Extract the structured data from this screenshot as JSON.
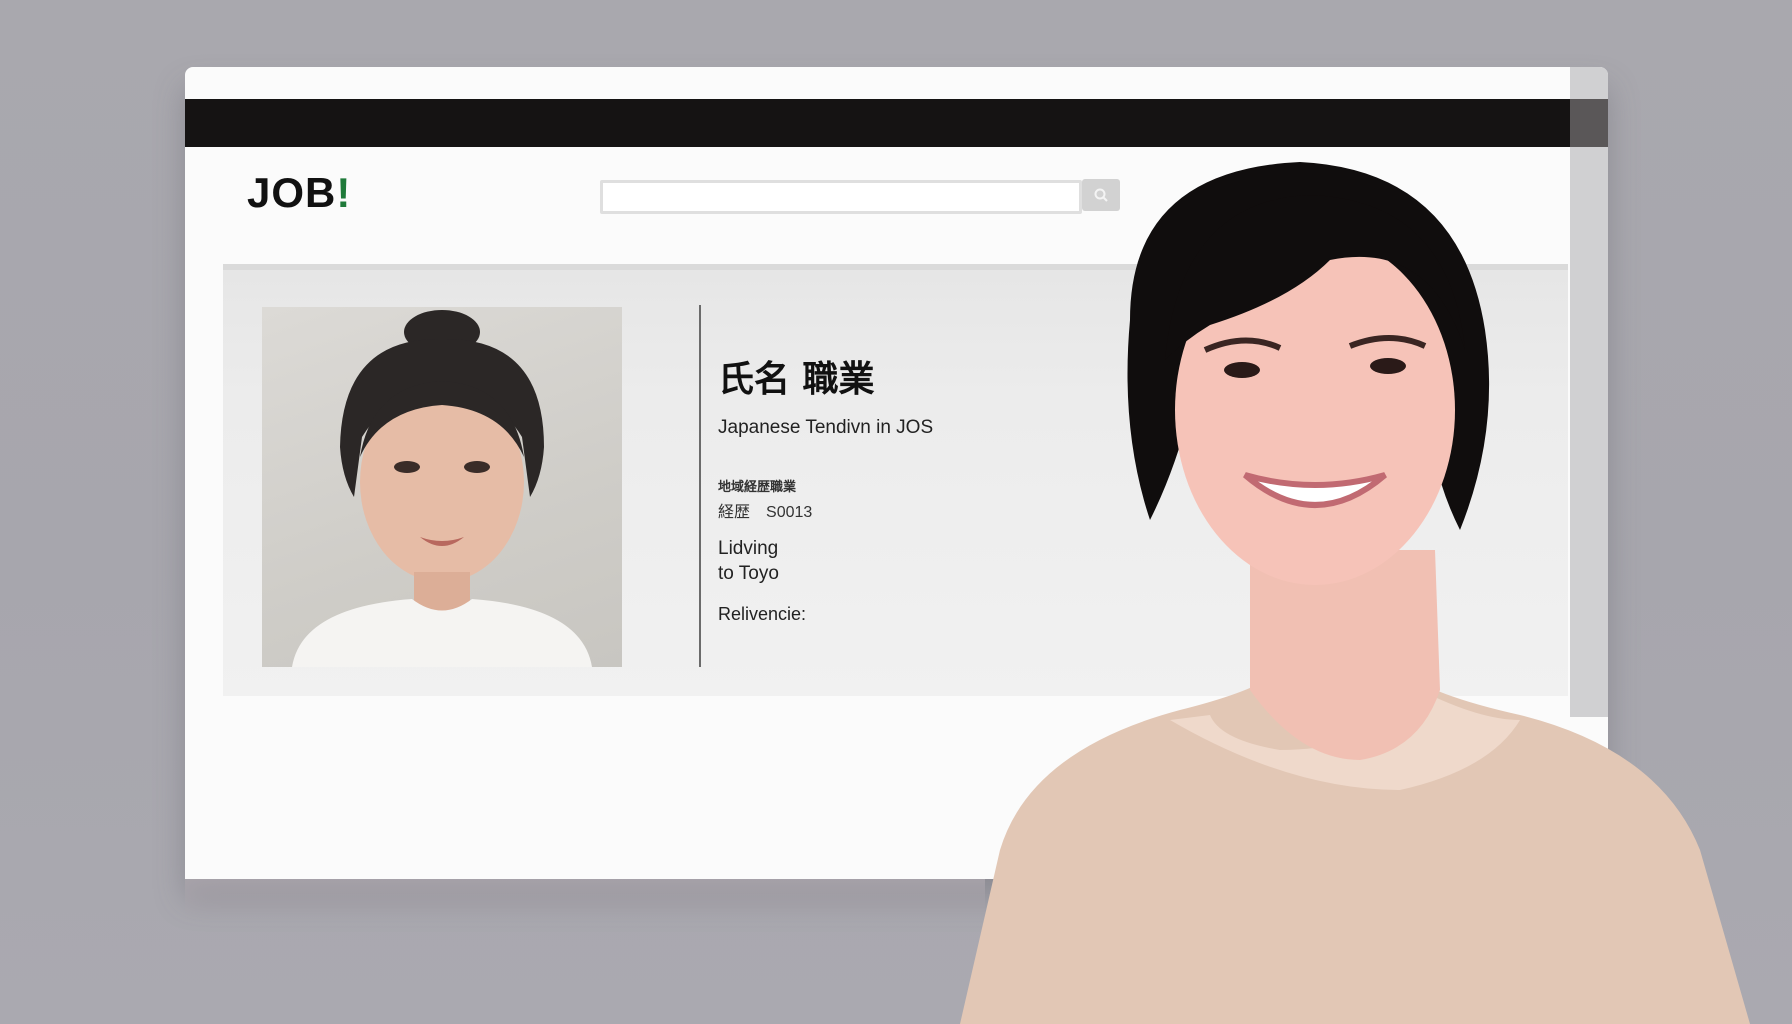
{
  "header": {
    "logo_text": "JOB",
    "logo_accent": "!",
    "search": {
      "placeholder": "",
      "button_icon": "search-icon"
    }
  },
  "profile": {
    "name": "氏名 職業",
    "job_title": "Japanese Tendivn in JOS",
    "meta_label": "地域経歴職業",
    "meta_key": "経歴",
    "meta_value": "S0013",
    "living_line1": "Lidving",
    "living_line2": "to Toyo",
    "relevance_label": "Relivencie:"
  },
  "colors": {
    "titlebar": "#151313",
    "background": "#a9a8ae",
    "panel": "#ececec",
    "logo_accent": "#1f7a3a"
  }
}
